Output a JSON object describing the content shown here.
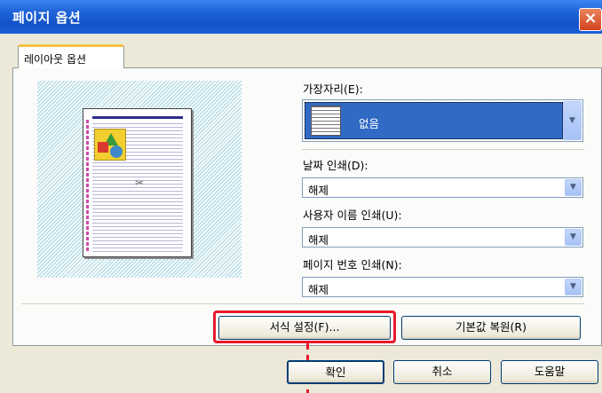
{
  "window": {
    "title": "페이지 옵션",
    "close_icon": "×"
  },
  "tabs": [
    {
      "label": "레이아웃 옵션"
    }
  ],
  "border": {
    "label": "가장자리(E):",
    "value": "없음"
  },
  "date_print": {
    "label": "날짜 인쇄(D):",
    "value": "해제"
  },
  "user_print": {
    "label": "사용자 이름 인쇄(U):",
    "value": "해제"
  },
  "page_number_print": {
    "label": "페이지 번호 인쇄(N):",
    "value": "해제"
  },
  "buttons": {
    "format": "서식 설정(F)...",
    "restore_default": "기본값 복원(R)",
    "ok": "확인",
    "cancel": "취소",
    "help": "도움말"
  },
  "icons": {
    "dropdown_arrow": "▼",
    "staple": "✂"
  },
  "colors": {
    "highlight": "#e8192c",
    "titlebar": "#1f63d8",
    "selection": "#316ac5"
  }
}
